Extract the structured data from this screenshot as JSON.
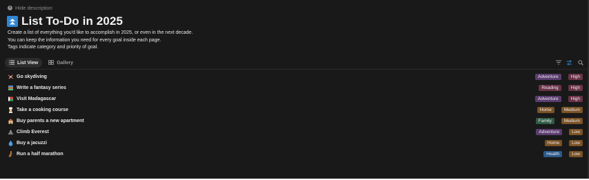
{
  "hide_description": {
    "label": "Hide description",
    "icon": "info-icon"
  },
  "page": {
    "title": "List To-Do in 2025",
    "icon": "double-chevron-up-icon",
    "icon_color": "#2f86d4",
    "description": [
      "Create a list of everything you'd like to accomplish in 2025, or even in the next decade.",
      "You can keep the information you need for every goal inside each page.",
      "Tags indicate category and priority of goal."
    ]
  },
  "tabs": [
    {
      "label": "List View",
      "icon": "list-icon",
      "active": true
    },
    {
      "label": "Gallery",
      "icon": "gallery-icon",
      "active": false
    }
  ],
  "toolbar": {
    "icons": [
      "filter-icon",
      "sort-icon",
      "search-icon"
    ],
    "accent": "#2f86d4"
  },
  "colors": {
    "Adventure": "#5a3d6e",
    "Reading": "#6a3347",
    "Home": "#7a5224",
    "Family": "#2f5c43",
    "Health": "#2b5a87",
    "High": "#6a3347",
    "Medium": "#7a5224",
    "Low": "#7a5224"
  },
  "items": [
    {
      "name": "Go skydiving",
      "emoji": "parachute",
      "category": "Adventure",
      "priority": "High"
    },
    {
      "name": "Write a fantasy series",
      "emoji": "books",
      "category": "Reading",
      "priority": "High"
    },
    {
      "name": "Visit Madagascar",
      "emoji": "flag",
      "category": "Adventure",
      "priority": "High"
    },
    {
      "name": "Take a cooking course",
      "emoji": "cook",
      "category": "Home",
      "priority": "Medium"
    },
    {
      "name": "Buy parents a new apartment",
      "emoji": "house",
      "category": "Family",
      "priority": "Medium"
    },
    {
      "name": "Climb Everest",
      "emoji": "mountain",
      "category": "Adventure",
      "priority": "Low"
    },
    {
      "name": "Buy a jacuzzi",
      "emoji": "droplet",
      "category": "Home",
      "priority": "Low"
    },
    {
      "name": "Run a half marathon",
      "emoji": "runner",
      "category": "Health",
      "priority": "Low"
    }
  ]
}
